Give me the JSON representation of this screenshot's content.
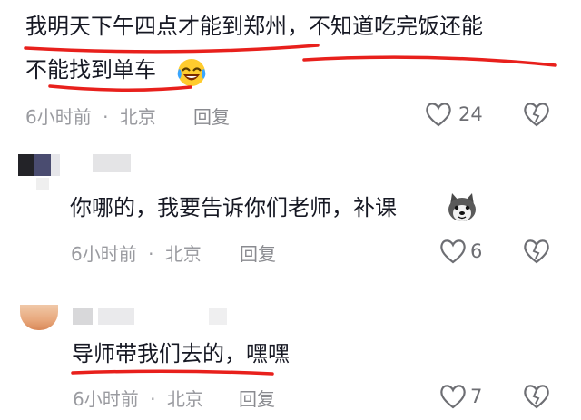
{
  "comments": [
    {
      "text_line1": "我明天下午四点才能到郑州，不知道吃完饭还能",
      "text_line2": "不能找到单车",
      "emoji": "laughing-crying-emoji",
      "time": "6小时前",
      "dot": "·",
      "location": "北京",
      "reply": "回复",
      "likes": "24"
    },
    {
      "text": "你哪的，我要告诉你们老师，补课",
      "emoji": "husky-dog-emoji",
      "time": "6小时前",
      "dot": "·",
      "location": "北京",
      "reply": "回复",
      "likes": "6"
    },
    {
      "text": "导师带我们去的，嘿嘿",
      "time": "6小时前",
      "dot": "·",
      "location": "北京",
      "reply": "回复",
      "likes": "7"
    }
  ],
  "colors": {
    "underline_red": "#e8201c",
    "meta_gray": "#9a9ba0",
    "text_dark": "#161823"
  },
  "icons": [
    "heart-icon",
    "dislike-heart-icon"
  ]
}
